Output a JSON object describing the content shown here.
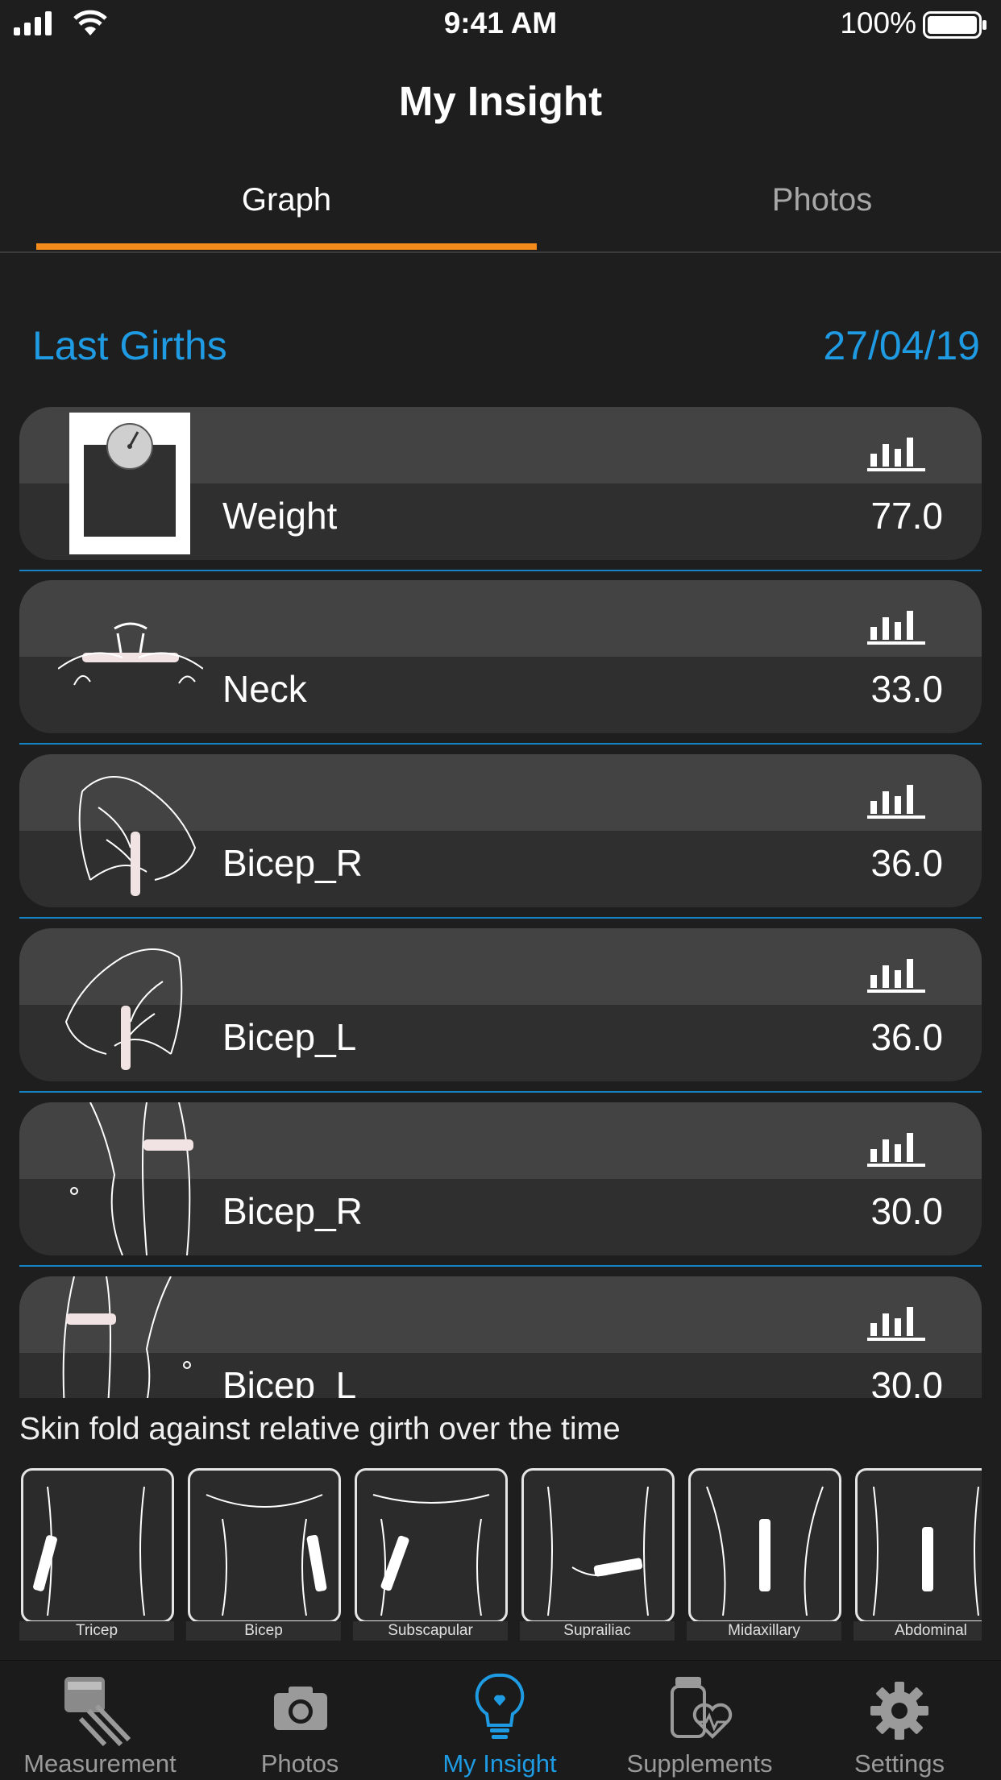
{
  "status": {
    "time": "9:41 AM",
    "battery": "100%"
  },
  "header": {
    "title": "My Insight"
  },
  "tabs": [
    {
      "label": "Graph",
      "active": true
    },
    {
      "label": "Photos",
      "active": false
    }
  ],
  "section": {
    "title": "Last Girths",
    "date": "27/04/19"
  },
  "girths": [
    {
      "name": "Weight",
      "value": "77.0",
      "icon": "scale-icon"
    },
    {
      "name": "Neck",
      "value": "33.0",
      "icon": "neck-illustration"
    },
    {
      "name": "Bicep_R",
      "value": "36.0",
      "icon": "bicep-right-illustration"
    },
    {
      "name": "Bicep_L",
      "value": "36.0",
      "icon": "bicep-left-illustration"
    },
    {
      "name": "Bicep_R",
      "value": "30.0",
      "icon": "thigh-right-illustration"
    },
    {
      "name": "Bicep_L",
      "value": "30.0",
      "icon": "thigh-left-illustration"
    }
  ],
  "skinfold": {
    "title": "Skin fold against relative girth over the time",
    "items": [
      "Tricep",
      "Bicep",
      "Subscapular",
      "Suprailiac",
      "Midaxillary",
      "Abdominal"
    ]
  },
  "tabbar": [
    {
      "label": "Measurement",
      "icon": "tape-caliper-icon",
      "active": false
    },
    {
      "label": "Photos",
      "icon": "camera-icon",
      "active": false
    },
    {
      "label": "My Insight",
      "icon": "lightbulb-icon",
      "active": true
    },
    {
      "label": "Supplements",
      "icon": "supplements-icon",
      "active": false
    },
    {
      "label": "Settings",
      "icon": "gear-icon",
      "active": false
    }
  ],
  "colors": {
    "accent": "#1e9be3",
    "tab_underline": "#f38a1b",
    "background": "#1e1e1e"
  }
}
